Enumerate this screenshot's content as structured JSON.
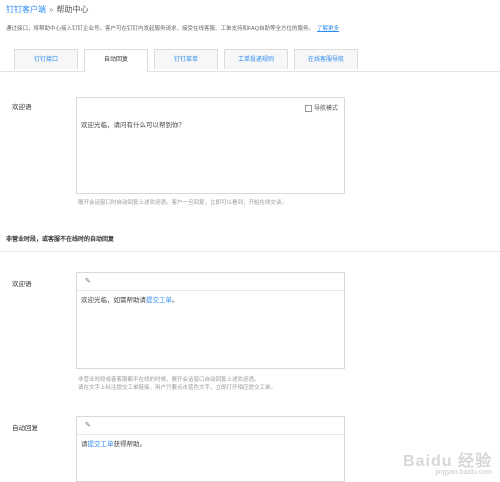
{
  "breadcrumb": {
    "root": "钉钉客户端",
    "sep": "»",
    "current": "帮助中心"
  },
  "description": {
    "text": "通过接口，将帮助中心接入钉钉企业号。客户可在钉钉内发起服务请求，接受在线客服、工单支持和FAQ自助等全方位的服务。",
    "more": "了解更多"
  },
  "tabs": [
    {
      "label": "钉钉接口",
      "active": false
    },
    {
      "label": "自动回复",
      "active": true
    },
    {
      "label": "钉钉菜单",
      "active": false
    },
    {
      "label": "工单投递规则",
      "active": false
    },
    {
      "label": "在线客服导航",
      "active": false
    }
  ],
  "greeting": {
    "label": "欢迎语",
    "nav_mode_label": "导航模式",
    "text": "欢迎光临，请问有什么可以帮到你？",
    "hint": "展开会话窗口时自动回复上述欢迎语。客户一旦回复，立即可以看到，开始在线交谈。"
  },
  "offhours": {
    "section_title": "非营业时段，或客服不在线时的自动回复",
    "greeting_label": "欢迎语",
    "greeting_pre": "欢迎光临，如需帮助请",
    "greeting_link": "提交工单",
    "greeting_post": "。",
    "hint1": "非营业时段或者客服都不在线的时候，展开会话窗口自动回复上述欢迎语。",
    "hint2": "请在文字上标注提交工单链接，用户只要点击蓝色文字，立即打开相应提交工单。",
    "auto_label": "自动回复",
    "auto_pre": "请",
    "auto_link": "提交工单",
    "auto_post": "获得帮助。"
  },
  "watermark": {
    "logo": "Baidu 经验",
    "url": "jingyan.baidu.com"
  },
  "colors": {
    "link": "#2d8cf0",
    "border": "#d9d9d9"
  }
}
